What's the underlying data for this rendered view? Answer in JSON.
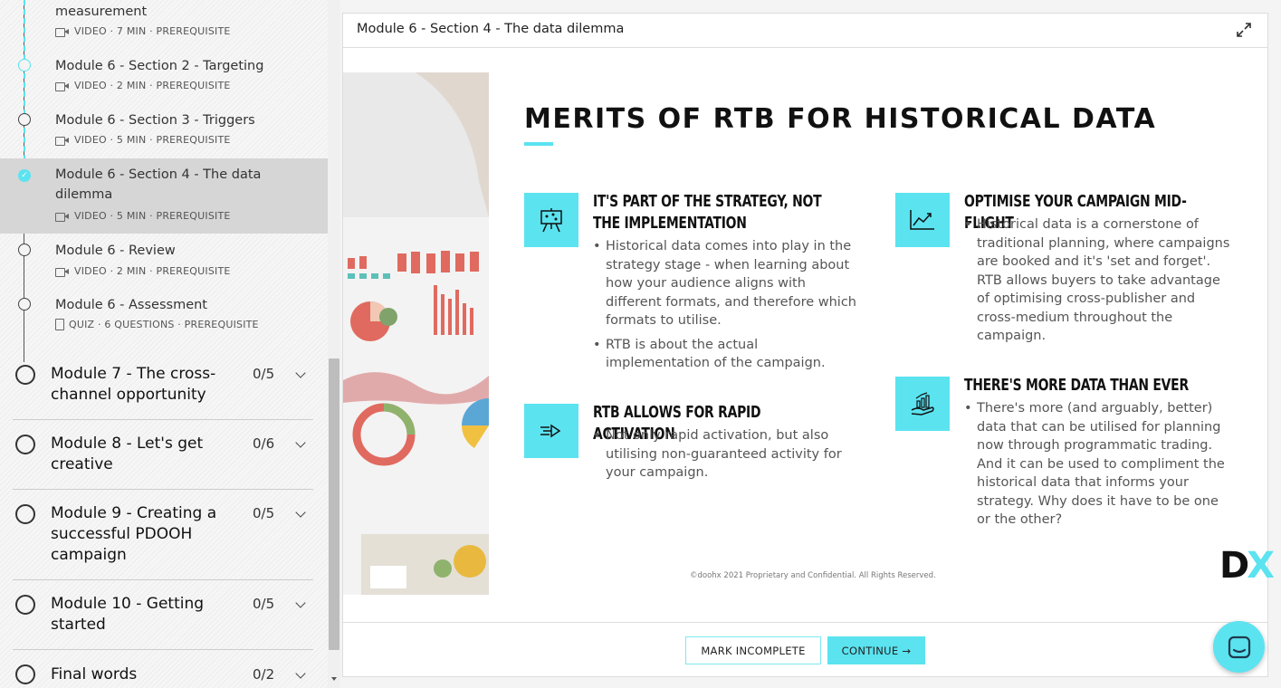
{
  "sidebar": {
    "lessons": [
      {
        "title": "measurement",
        "meta": "VIDEO · 7 MIN · PREREQUISITE",
        "type": "video"
      },
      {
        "title": "Module 6 - Section 2 - Targeting",
        "meta": "VIDEO · 2 MIN · PREREQUISITE",
        "type": "video"
      },
      {
        "title": "Module 6 - Section 3 - Triggers",
        "meta": "VIDEO · 5 MIN · PREREQUISITE",
        "type": "video"
      },
      {
        "title": "Module 6 - Section 4 - The data dilemma",
        "meta": "VIDEO · 5 MIN · PREREQUISITE",
        "type": "video",
        "active": true
      },
      {
        "title": "Module 6 - Review",
        "meta": "VIDEO · 2 MIN · PREREQUISITE",
        "type": "video"
      },
      {
        "title": "Module 6 - Assessment",
        "meta": "QUIZ · 6 QUESTIONS · PREREQUISITE",
        "type": "quiz"
      }
    ],
    "modules": [
      {
        "title": "Module 7 - The cross-channel opportunity",
        "count": "0/5"
      },
      {
        "title": "Module 8 - Let's get creative",
        "count": "0/6"
      },
      {
        "title": "Module 9 - Creating a successful PDOOH campaign",
        "count": "0/5"
      },
      {
        "title": "Module 10 - Getting started",
        "count": "0/5"
      },
      {
        "title": "Final words",
        "count": "0/2"
      }
    ]
  },
  "panel": {
    "title": "Module 6 - Section 4 - The data dilemma"
  },
  "slide": {
    "heading": "MERITS OF RTB FOR HISTORICAL  DATA",
    "points": [
      {
        "title": "IT'S PART OF THE STRATEGY, NOT THE IMPLEMENTATION",
        "icon": "presentation-board-icon",
        "bullets": [
          "Historical data comes into play in the strategy stage - when learning about how your audience aligns with different formats, and therefore which formats to utilise.",
          "RTB is about the actual implementation of the campaign."
        ]
      },
      {
        "title": "RTB ALLOWS FOR RAPID ACTIVATION",
        "icon": "fast-arrow-icon",
        "bullets": [
          "Not only rapid activation, but also utilising non-guaranteed activity for your campaign."
        ]
      },
      {
        "title": "OPTIMISE YOUR CAMPAIGN MID-FLIGHT",
        "icon": "line-chart-icon",
        "bullets": [
          "Historical data is a cornerstone of traditional planning, where campaigns are booked and it's 'set and forget'. RTB allows buyers to take advantage of optimising cross-publisher and cross-medium throughout the campaign."
        ]
      },
      {
        "title": "THERE'S MORE DATA THAN EVER",
        "icon": "growth-hand-icon",
        "bullets": [
          "There's more (and arguably, better) data that can be utilised for planning now through programmatic trading. And it can be used to compliment the historical data that informs your strategy. Why does it have to be one or the other?"
        ]
      }
    ],
    "footer_note": "©doohx 2021 Proprietary and Confidential. All Rights Reserved.",
    "logo_d": "D",
    "logo_x": "X"
  },
  "buttons": {
    "mark_incomplete": "MARK INCOMPLETE",
    "continue": "CONTINUE →"
  },
  "colors": {
    "accent": "#5be3f0",
    "active_row": "#d6d6d6"
  }
}
